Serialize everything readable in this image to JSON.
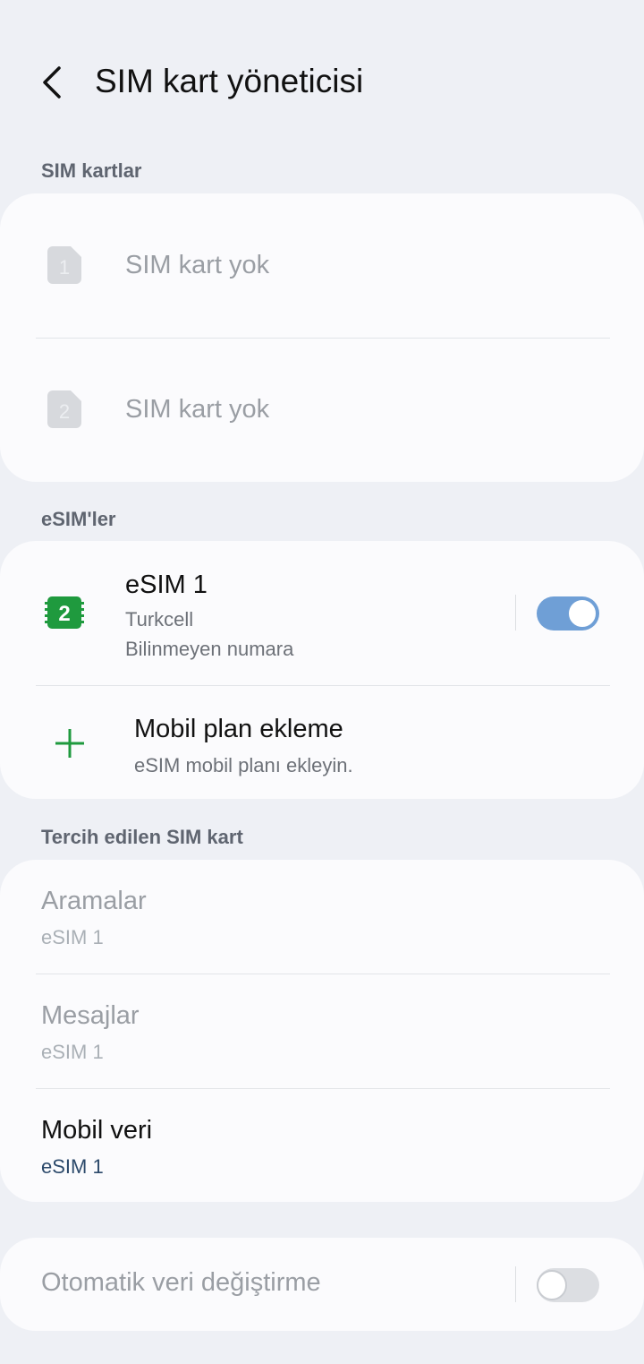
{
  "header": {
    "title": "SIM kart yöneticisi"
  },
  "sim_section": {
    "label": "SIM kartlar",
    "items": [
      {
        "slot": "1",
        "text": "SIM kart yok"
      },
      {
        "slot": "2",
        "text": "SIM kart yok"
      }
    ]
  },
  "esim_section": {
    "label": "eSIM'ler",
    "esim": {
      "icon_number": "2",
      "name": "eSIM 1",
      "carrier": "Turkcell",
      "number": "Bilinmeyen numara",
      "enabled": true
    },
    "add_plan": {
      "title": "Mobil plan ekleme",
      "subtitle": "eSIM mobil planı ekleyin."
    }
  },
  "preferred_section": {
    "label": "Tercih edilen SIM kart",
    "items": [
      {
        "title": "Aramalar",
        "value": "eSIM 1",
        "enabled": false
      },
      {
        "title": "Mesajlar",
        "value": "eSIM 1",
        "enabled": false
      },
      {
        "title": "Mobil veri",
        "value": "eSIM 1",
        "enabled": true
      }
    ]
  },
  "auto_switch": {
    "label": "Otomatik veri değiştirme",
    "enabled": false
  },
  "colors": {
    "accent_toggle": "#6f9fd6",
    "esim_icon": "#1f9a3e",
    "add_icon": "#1f9a3e",
    "value_link": "#2c4a6b"
  }
}
